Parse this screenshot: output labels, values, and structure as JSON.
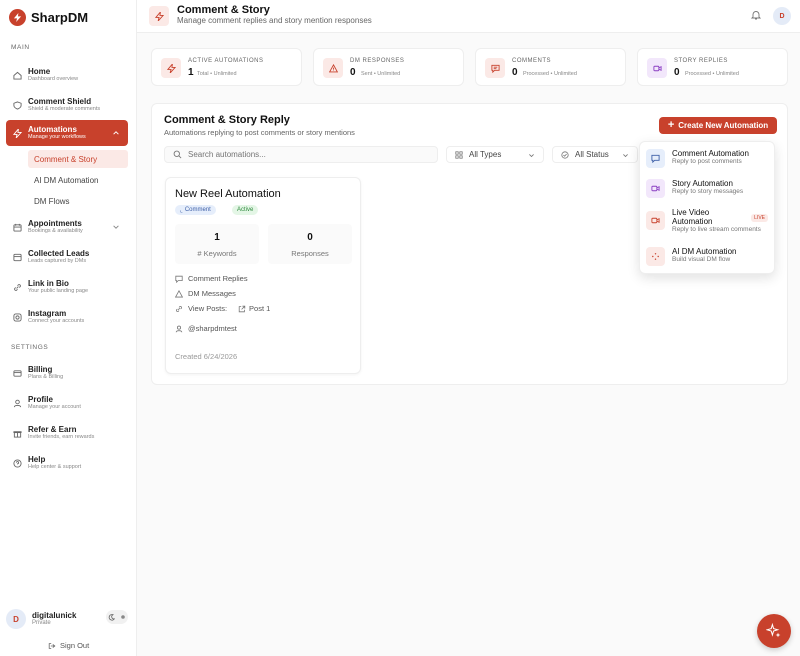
{
  "brand": {
    "name": "SharpDM"
  },
  "sidebar": {
    "main_label": "MAIN",
    "settings_label": "SETTINGS",
    "items": [
      {
        "title": "Home",
        "sub": "Dashboard overview",
        "icon": "home-icon"
      },
      {
        "title": "Comment Shield",
        "sub": "Shield & moderate comments",
        "icon": "shield-icon"
      },
      {
        "title": "Automations",
        "sub": "Manage your workflows",
        "icon": "bolt-icon"
      },
      {
        "title": "Appointments",
        "sub": "Bookings & availability",
        "icon": "calendar-icon"
      },
      {
        "title": "Collected Leads",
        "sub": "Leads captured by DMs",
        "icon": "leads-icon"
      },
      {
        "title": "Link in Bio",
        "sub": "Your public landing page",
        "icon": "link-icon"
      },
      {
        "title": "Instagram",
        "sub": "Connect your accounts",
        "icon": "instagram-icon"
      }
    ],
    "sub_items": [
      "Comment & Story",
      "AI DM Automation",
      "DM Flows"
    ],
    "settings_items": [
      {
        "title": "Billing",
        "sub": "Plans & Billing",
        "icon": "billing-icon"
      },
      {
        "title": "Profile",
        "sub": "Manage your account",
        "icon": "profile-icon"
      },
      {
        "title": "Refer & Earn",
        "sub": "Invite friends, earn rewards",
        "icon": "gift-icon"
      },
      {
        "title": "Help",
        "sub": "Help center & support",
        "icon": "help-icon"
      }
    ],
    "user": {
      "initial": "D",
      "name": "digitalunick",
      "plan": "Private"
    },
    "signout": "Sign Out"
  },
  "header": {
    "title": "Comment & Story",
    "subtitle": "Manage comment replies and story mention responses",
    "avatar_initial": "D"
  },
  "stats": [
    {
      "label": "ACTIVE AUTOMATIONS",
      "value": "1",
      "note": "Total • Unlimited"
    },
    {
      "label": "DM RESPONSES",
      "value": "0",
      "note": "Sent • Unlimited"
    },
    {
      "label": "COMMENTS",
      "value": "0",
      "note": "Processed • Unlimited"
    },
    {
      "label": "STORY REPLIES",
      "value": "0",
      "note": "Processed • Unlimited"
    }
  ],
  "main": {
    "title": "Comment & Story Reply",
    "subtitle": "Automations replying to post comments or story mentions",
    "create_label": "Create New Automation",
    "search_placeholder": "Search automations...",
    "filter_types": "All Types",
    "filter_status": "All Status"
  },
  "automation": {
    "title": "New Reel Automation",
    "type_badge": "Comment",
    "status_badge": "Active",
    "keywords_value": "1",
    "keywords_label": "# Keywords",
    "responses_value": "0",
    "responses_label": "Responses",
    "detail_comment": "Comment Replies",
    "detail_dm": "DM Messages",
    "detail_posts_label": "View Posts:",
    "detail_posts_link": "Post 1",
    "account": "@sharpdmtest",
    "created": "Created 6/24/2026"
  },
  "dropdown": [
    {
      "title": "Comment Automation",
      "sub": "Reply to post comments",
      "bg": "#e6eefb",
      "color": "#3d5fa7"
    },
    {
      "title": "Story Automation",
      "sub": "Reply to story messages",
      "bg": "#f2e7fb",
      "color": "#8a3dc2"
    },
    {
      "title": "Live Video Automation",
      "sub": "Reply to live stream comments",
      "badge": "LIVE",
      "bg": "#fbe9e6",
      "color": "#c8412c"
    },
    {
      "title": "AI DM Automation",
      "sub": "Build visual DM flow",
      "bg": "#fbe9e6",
      "color": "#c8412c"
    }
  ],
  "colors": {
    "accent": "#c8412c"
  }
}
